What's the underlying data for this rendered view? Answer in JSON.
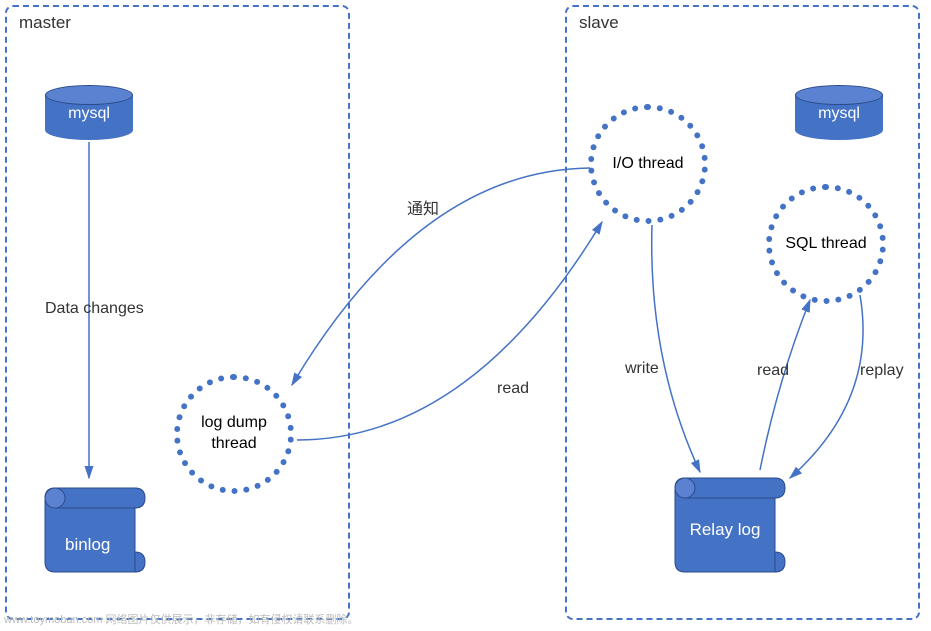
{
  "diagram": {
    "master": {
      "title": "master",
      "db": "mysql",
      "thread": "log dump thread",
      "storage": "binlog",
      "vertical_label": "Data changes"
    },
    "slave": {
      "title": "slave",
      "db": "mysql",
      "io_thread": "I/O thread",
      "sql_thread": "SQL thread",
      "storage": "Relay log"
    },
    "edges": {
      "notify": "通知",
      "read1": "read",
      "write": "write",
      "read2": "read",
      "replay": "replay"
    },
    "watermark": "www.toymoban.com 网络图片仅供展示，非存储，如有侵权请联系删除。"
  }
}
